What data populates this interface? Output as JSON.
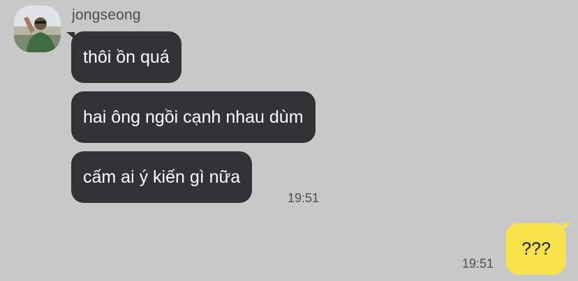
{
  "chat": {
    "sender": {
      "name": "jongseong",
      "avatar_icon": "profile-photo-avatar"
    },
    "incoming": [
      {
        "text": "thôi ồn quá"
      },
      {
        "text": "hai ông ngồi cạnh nhau dùm"
      },
      {
        "text": "cấm ai ý kiến gì nữa"
      }
    ],
    "incoming_time": "19:51",
    "outgoing": [
      {
        "text": "???"
      }
    ],
    "outgoing_time": "19:51"
  },
  "colors": {
    "background": "#c8c8c8",
    "incoming_bubble": "#333335",
    "outgoing_bubble": "#f7e24a"
  }
}
